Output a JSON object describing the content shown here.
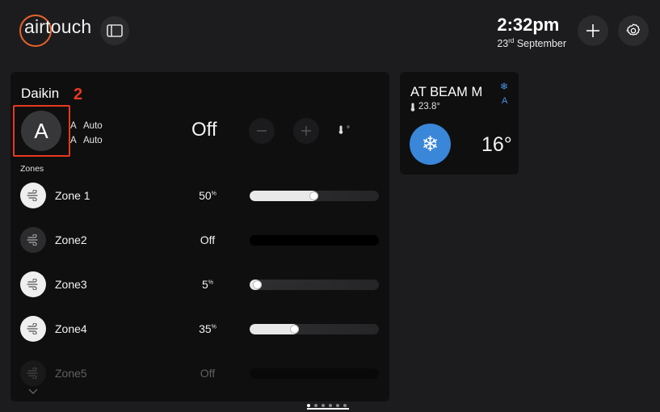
{
  "header": {
    "logo_text": "airtouch",
    "time": "2:32pm",
    "date_day": "23",
    "date_suffix": "rd",
    "date_month": "September",
    "brand_color": "#e8632a"
  },
  "ac": {
    "brand": "Daikin",
    "annotation_number": "2",
    "mode_letter": "A",
    "mode_lines": [
      {
        "key": "A",
        "value": "Auto"
      },
      {
        "key": "A",
        "value": "Auto"
      }
    ],
    "power_state": "Off",
    "temp_indicator": "°"
  },
  "zones": {
    "title": "Zones",
    "items": [
      {
        "name": "Zone 1",
        "value": "50",
        "unit": "%",
        "percent": 50,
        "on": true
      },
      {
        "name": "Zone2",
        "value": "Off",
        "unit": "",
        "percent": 0,
        "on": false
      },
      {
        "name": "Zone3",
        "value": "5",
        "unit": "%",
        "percent": 5,
        "on": true
      },
      {
        "name": "Zone4",
        "value": "35",
        "unit": "%",
        "percent": 35,
        "on": true
      },
      {
        "name": "Zone5",
        "value": "Off",
        "unit": "",
        "percent": 0,
        "on": false
      }
    ]
  },
  "unit_card": {
    "name": "AT BEAM M",
    "mode_badge": "A",
    "room_temp": "23.8°",
    "setpoint": "16°",
    "accent_color": "#3a86d8"
  },
  "pager": {
    "page_count": 6,
    "active_index": 0
  }
}
